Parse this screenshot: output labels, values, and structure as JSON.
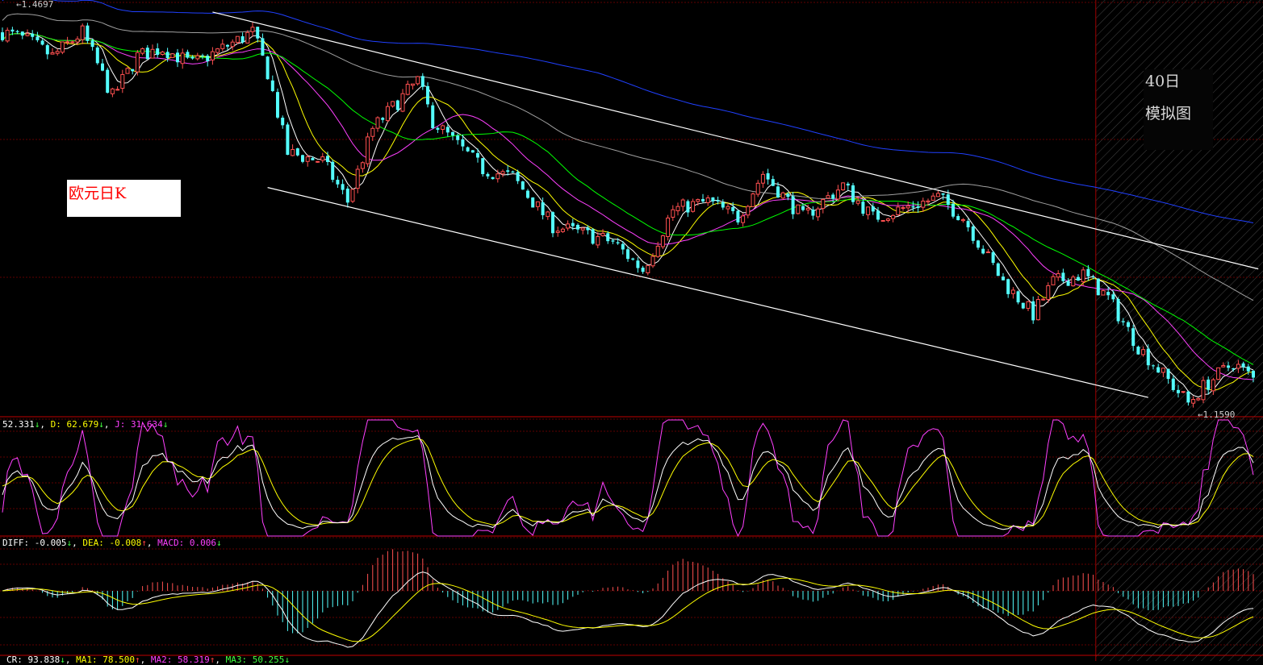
{
  "chart_data": {
    "type": "candlestick",
    "title": "欧元日K",
    "candle_count": 251,
    "price_keypoints": [
      [
        0,
        1.4482
      ],
      [
        5,
        1.4421
      ],
      [
        10,
        1.4299
      ],
      [
        16,
        1.4482
      ],
      [
        22,
        1.3992
      ],
      [
        27,
        1.4299
      ],
      [
        32,
        1.436
      ],
      [
        38,
        1.4237
      ],
      [
        50,
        1.4482
      ],
      [
        53,
        1.4176
      ],
      [
        57,
        1.3563
      ],
      [
        64,
        1.3502
      ],
      [
        69,
        1.3195
      ],
      [
        74,
        1.3747
      ],
      [
        83,
        1.4115
      ],
      [
        86,
        1.3808
      ],
      [
        96,
        1.344
      ],
      [
        102,
        1.3379
      ],
      [
        110,
        1.3011
      ],
      [
        122,
        1.2889
      ],
      [
        128,
        1.2674
      ],
      [
        134,
        1.3134
      ],
      [
        141,
        1.3195
      ],
      [
        147,
        1.3073
      ],
      [
        152,
        1.341
      ],
      [
        160,
        1.3073
      ],
      [
        168,
        1.3318
      ],
      [
        174,
        1.3073
      ],
      [
        187,
        1.3226
      ],
      [
        192,
        1.3073
      ],
      [
        200,
        1.2582
      ],
      [
        206,
        1.2337
      ],
      [
        210,
        1.2582
      ],
      [
        216,
        1.2643
      ],
      [
        221,
        1.246
      ],
      [
        227,
        1.2092
      ],
      [
        237,
        1.1663
      ],
      [
        240,
        1.1785
      ],
      [
        246,
        1.1969
      ],
      [
        250,
        1.1846
      ]
    ],
    "ylim": [
      1.159,
      1.4697
    ],
    "max_marker": "1.4697",
    "min_marker": "1.1590",
    "moving_averages": [
      {
        "period": 5,
        "color": "#ffffff"
      },
      {
        "period": 10,
        "color": "#ffff00"
      },
      {
        "period": 20,
        "color": "#ff40ff"
      },
      {
        "period": 30,
        "color": "#00ff00"
      },
      {
        "period": 60,
        "color": "#a0a0a0"
      },
      {
        "period": 120,
        "color": "#2040ff"
      }
    ],
    "trendlines": [
      {
        "from": [
          42,
          1.4636
        ],
        "to": [
          251,
          1.2683
        ]
      },
      {
        "from": [
          53,
          1.3302
        ],
        "to": [
          229,
          1.1706
        ]
      }
    ],
    "simulated_from_index": 219,
    "up_color": "#ff5050",
    "down_color": "#54ffff"
  },
  "labels": {
    "title": "欧元日K",
    "sim_days": "40日",
    "sim_text": "模拟图",
    "kdj": {
      "k": "52.331",
      "k_arrow": "↓",
      "d": "D: 62.679",
      "d_arrow": "↓",
      "j": "J: 31.634",
      "j_arrow": "↓"
    },
    "macd": {
      "diff": "DIFF: -0.005",
      "diff_arrow": "↓",
      "dea": "DEA: -0.008",
      "dea_arrow": "↑",
      "macd": "MACD: 0.006",
      "macd_arrow": "↓"
    },
    "cr": {
      "cr": "CR: 93.838",
      "cr_arrow": "↓",
      "ma1": "MA1: 78.500",
      "ma1_arrow": "↑",
      "ma2": "MA2: 58.319",
      "ma2_arrow": "↑",
      "ma3": "MA3: 50.255",
      "ma3_arrow": "↓"
    }
  }
}
